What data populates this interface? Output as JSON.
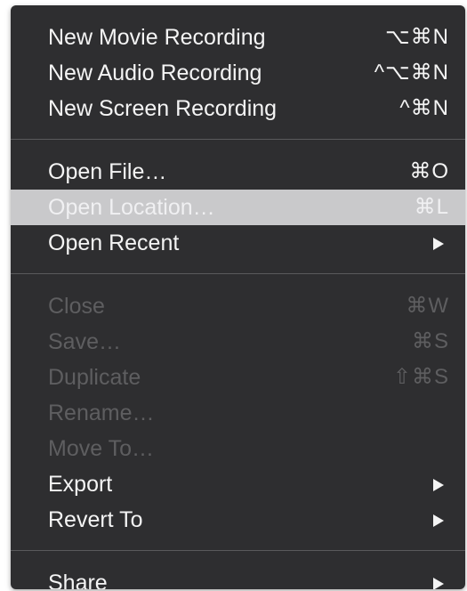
{
  "menu": {
    "groups": [
      [
        {
          "label": "New Movie Recording",
          "shortcut": "⌥⌘N"
        },
        {
          "label": "New Audio Recording",
          "shortcut": "^⌥⌘N"
        },
        {
          "label": "New Screen Recording",
          "shortcut": "^⌘N"
        }
      ],
      [
        {
          "label": "Open File…",
          "shortcut": "⌘O"
        },
        {
          "label": "Open Location…",
          "shortcut": "⌘L"
        },
        {
          "label": "Open Recent"
        }
      ],
      [
        {
          "label": "Close",
          "shortcut": "⌘W"
        },
        {
          "label": "Save…",
          "shortcut": "⌘S"
        },
        {
          "label": "Duplicate",
          "shortcut": "⇧⌘S"
        },
        {
          "label": "Rename…"
        },
        {
          "label": "Move To…"
        },
        {
          "label": "Export"
        },
        {
          "label": "Revert To"
        }
      ],
      [
        {
          "label": "Share"
        }
      ]
    ]
  }
}
